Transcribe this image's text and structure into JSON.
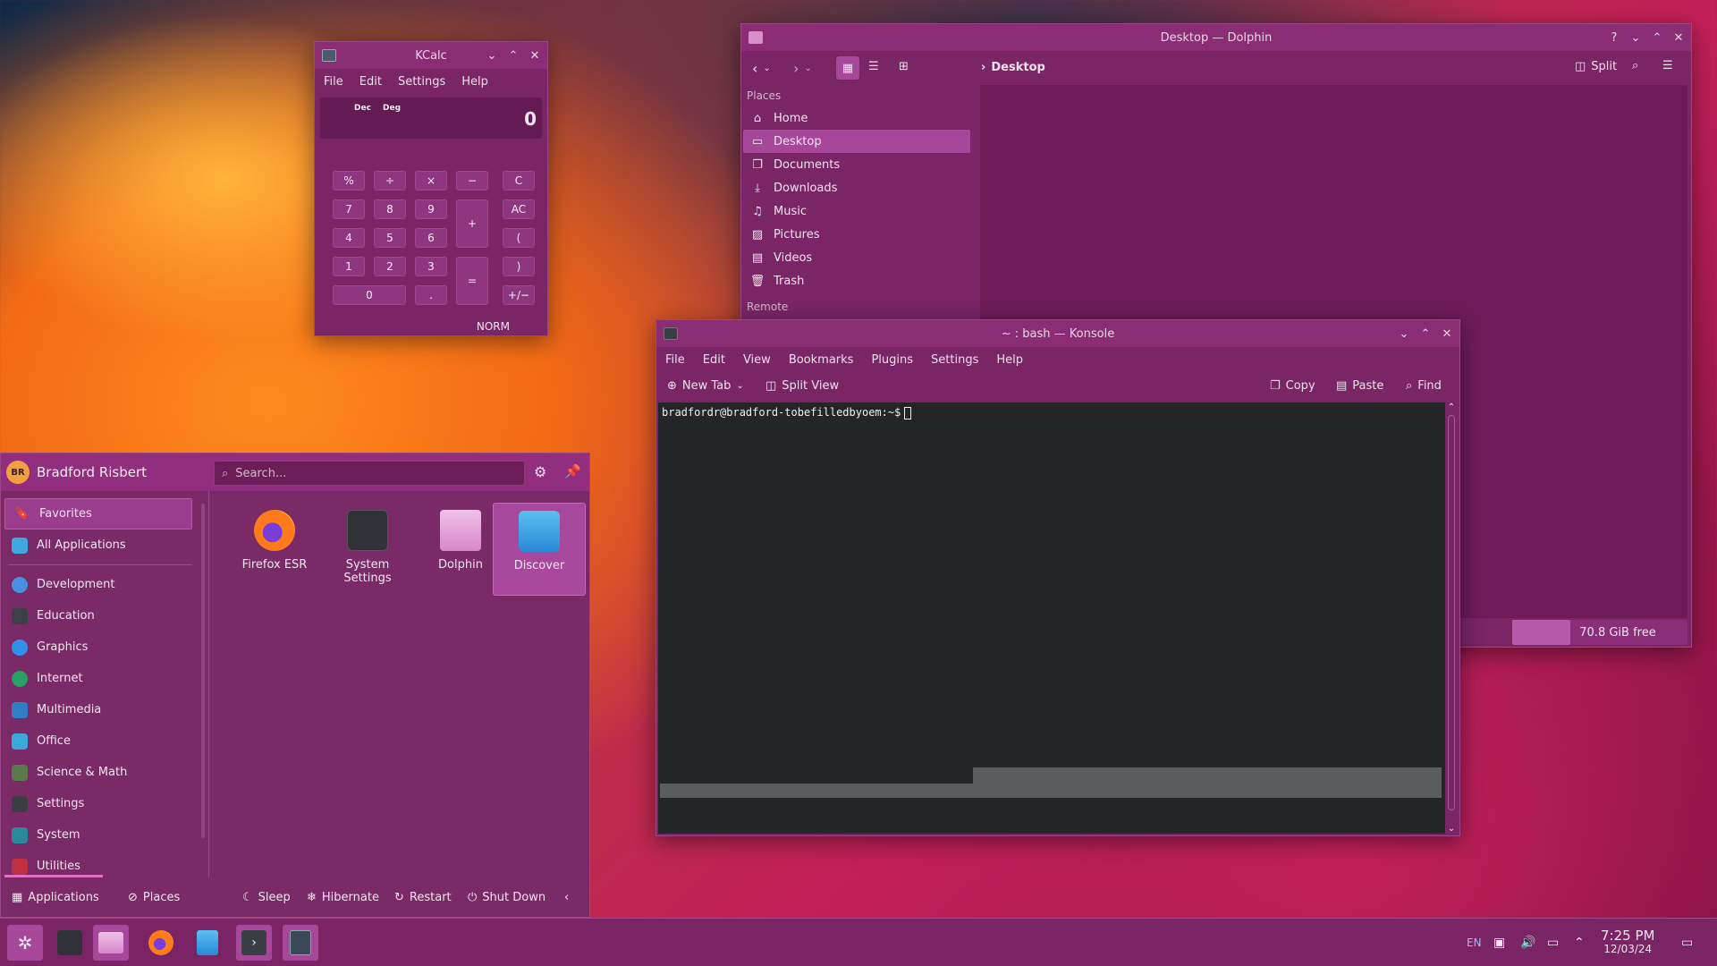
{
  "kcalc": {
    "title": "KCalc",
    "menu": [
      "File",
      "Edit",
      "Settings",
      "Help"
    ],
    "display": {
      "mode1": "Dec",
      "mode2": "Deg",
      "value": "0"
    },
    "buttons": [
      "%",
      "÷",
      "×",
      "−",
      "C",
      "7",
      "8",
      "9",
      "+",
      "AC",
      "4",
      "5",
      "6",
      "(",
      "1",
      "2",
      "3",
      "=",
      ")",
      "0",
      ".",
      "+/−"
    ],
    "status": "NORM"
  },
  "dolphin": {
    "title": "Desktop — Dolphin",
    "breadcrumb": "Desktop",
    "split_label": "Split",
    "places_header": "Places",
    "places": [
      "Home",
      "Desktop",
      "Documents",
      "Downloads",
      "Music",
      "Pictures",
      "Videos",
      "Trash"
    ],
    "remote_header": "Remote",
    "free_space": "70.8 GiB free",
    "free_fraction": 0.33
  },
  "konsole": {
    "title": "~ : bash — Konsole",
    "menu": [
      "File",
      "Edit",
      "View",
      "Bookmarks",
      "Plugins",
      "Settings",
      "Help"
    ],
    "toolbar": {
      "new_tab": "New Tab",
      "split_view": "Split View",
      "copy": "Copy",
      "paste": "Paste",
      "find": "Find"
    },
    "prompt": "bradfordr@bradford-tobefilledbyoem:~$"
  },
  "launcher": {
    "avatar_initials": "BR",
    "user_name": "Bradford Risbert",
    "search_placeholder": "Search...",
    "categories": [
      "Favorites",
      "All Applications",
      "Development",
      "Education",
      "Graphics",
      "Internet",
      "Multimedia",
      "Office",
      "Science & Math",
      "Settings",
      "System",
      "Utilities"
    ],
    "favorites": [
      {
        "label1": "Firefox ESR",
        "label2": ""
      },
      {
        "label1": "System",
        "label2": "Settings"
      },
      {
        "label1": "Dolphin",
        "label2": ""
      },
      {
        "label1": "Discover",
        "label2": ""
      }
    ],
    "footer": {
      "applications": "Applications",
      "places": "Places",
      "sleep": "Sleep",
      "hibernate": "Hibernate",
      "restart": "Restart",
      "shutdown": "Shut Down"
    }
  },
  "taskbar": {
    "lang": "EN",
    "time": "7:25 PM",
    "date": "12/03/24"
  },
  "colors": {
    "accent": "#a6479a",
    "panel": "#7a2566",
    "terminal_bg": "#232627"
  }
}
